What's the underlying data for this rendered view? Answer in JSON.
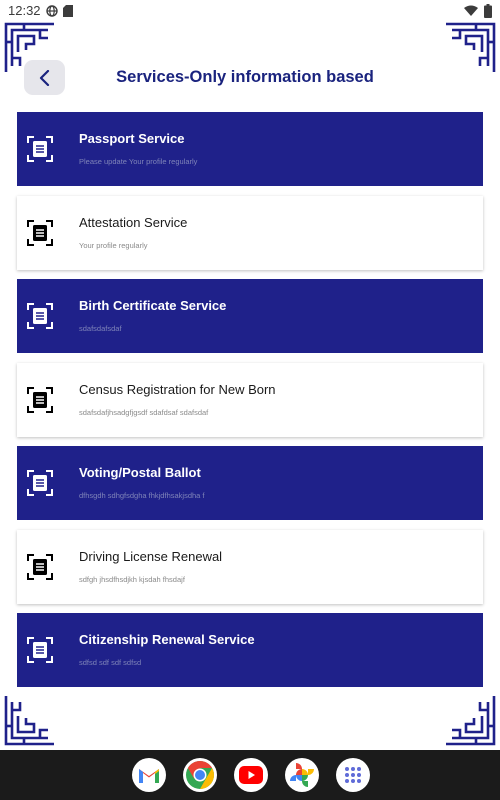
{
  "status_bar": {
    "time": "12:32"
  },
  "header": {
    "title": "Services-Only information based"
  },
  "theme": {
    "primary": "#1f218a",
    "title_color": "#1a237e",
    "card_light": "#ffffff"
  },
  "services": [
    {
      "title": "Passport Service",
      "subtitle": "Please update Your profile regularly",
      "style": "dark"
    },
    {
      "title": "Attestation Service",
      "subtitle": "Your profile regularly",
      "style": "light"
    },
    {
      "title": "Birth Certificate Service",
      "subtitle": "sdafsdafsdaf",
      "style": "dark"
    },
    {
      "title": "Census Registration for New Born",
      "subtitle": "sdafsdafjhsadgfjgsdf sdafdsaf sdafsdaf",
      "style": "light"
    },
    {
      "title": "Voting/Postal Ballot",
      "subtitle": "dfhsgdh sdhgfsdgha fhkjdfhsakjsdha f",
      "style": "dark"
    },
    {
      "title": "Driving License Renewal",
      "subtitle": "sdfgh jhsdfhsdjkh kjsdah fhsdajf",
      "style": "light"
    },
    {
      "title": "Citizenship Renewal Service",
      "subtitle": "sdfsd sdf sdf sdfsd",
      "style": "dark"
    }
  ],
  "dock": [
    {
      "icon": "gmail-icon"
    },
    {
      "icon": "chrome-icon"
    },
    {
      "icon": "youtube-icon"
    },
    {
      "icon": "photos-icon"
    },
    {
      "icon": "app-drawer-icon"
    }
  ]
}
